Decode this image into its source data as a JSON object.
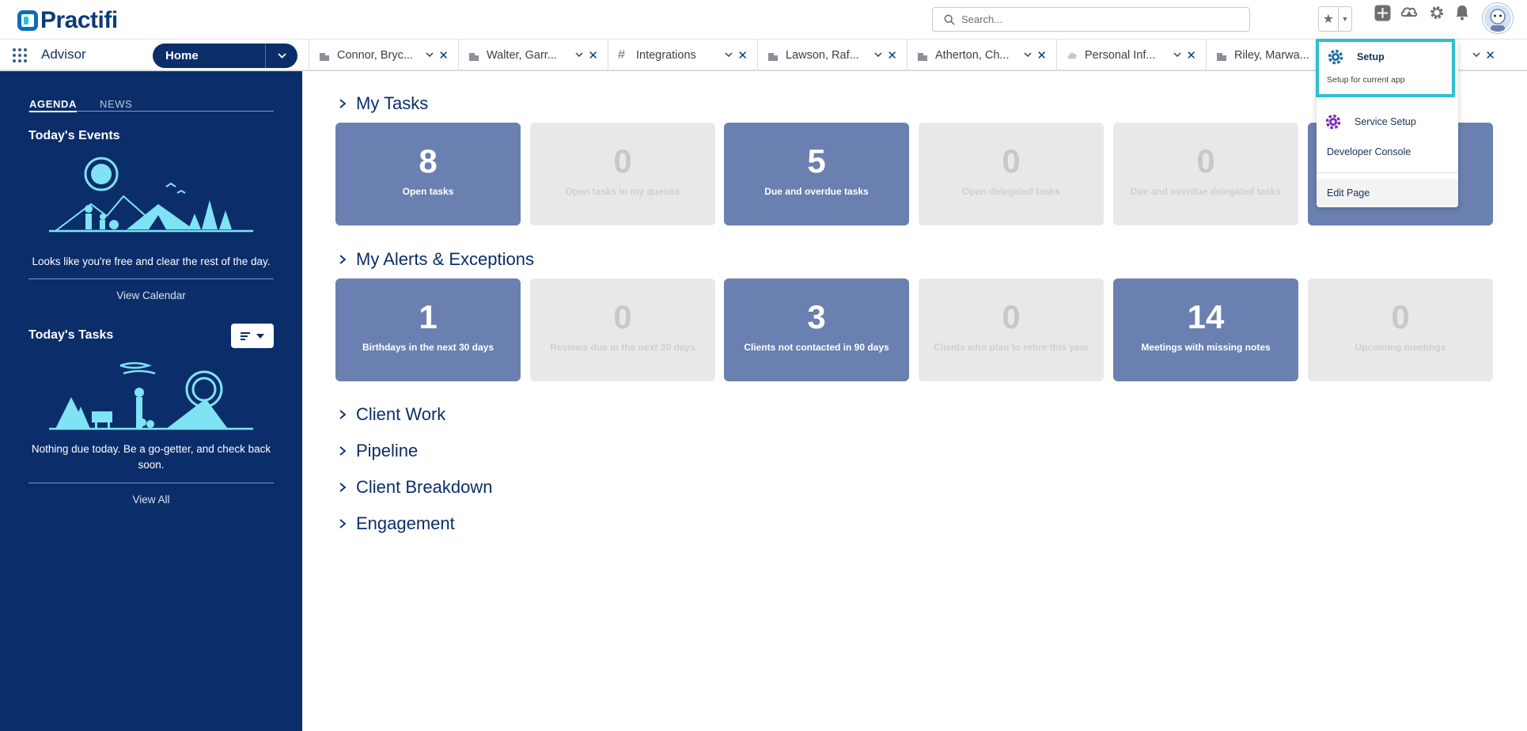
{
  "brand": {
    "name": "Practifi"
  },
  "search": {
    "placeholder": "Search..."
  },
  "nav": {
    "app_name": "Advisor",
    "home_tab": "Home",
    "tabs": [
      {
        "label": "Connor, Bryc...",
        "icon": "account-icon"
      },
      {
        "label": "Walter, Garr...",
        "icon": "account-icon"
      },
      {
        "label": "Integrations",
        "icon": "hash-icon"
      },
      {
        "label": "Lawson, Raf...",
        "icon": "account-icon"
      },
      {
        "label": "Atherton, Ch...",
        "icon": "account-icon"
      },
      {
        "label": "Personal Inf...",
        "icon": "cloud-icon"
      },
      {
        "label": "Riley, Marwa...",
        "icon": "account-icon"
      }
    ]
  },
  "sidebar": {
    "tabs": [
      "AGENDA",
      "NEWS"
    ],
    "events": {
      "heading": "Today's Events",
      "empty_text": "Looks like you're free and clear the rest of the day.",
      "link": "View Calendar"
    },
    "tasks": {
      "heading": "Today's Tasks",
      "empty_text": "Nothing due today. Be a go-getter, and check back soon.",
      "link": "View All"
    }
  },
  "sections": {
    "my_tasks": {
      "title": "My Tasks",
      "cards": [
        {
          "value": "8",
          "label": "Open tasks",
          "active": true
        },
        {
          "value": "0",
          "label": "Open tasks in my queues",
          "active": false
        },
        {
          "value": "5",
          "label": "Due and overdue tasks",
          "active": true
        },
        {
          "value": "0",
          "label": "Open delegated tasks",
          "active": false
        },
        {
          "value": "0",
          "label": "Due and overdue delegated tasks",
          "active": false
        },
        {
          "value": "",
          "label": "",
          "active": true
        }
      ]
    },
    "alerts": {
      "title": "My Alerts & Exceptions",
      "cards": [
        {
          "value": "1",
          "label": "Birthdays in the next 30 days",
          "active": true
        },
        {
          "value": "0",
          "label": "Reviews due in the next 30 days",
          "active": false
        },
        {
          "value": "3",
          "label": "Clients not contacted in 90 days",
          "active": true
        },
        {
          "value": "0",
          "label": "Clients who plan to retire this year",
          "active": false
        },
        {
          "value": "14",
          "label": "Meetings with missing notes",
          "active": true
        },
        {
          "value": "0",
          "label": "Upcoming meetings",
          "active": false
        }
      ]
    },
    "collapsed": [
      "Client Work",
      "Pipeline",
      "Client Breakdown",
      "Engagement"
    ]
  },
  "setup_menu": {
    "setup_title": "Setup",
    "setup_subtitle": "Setup for current app",
    "service_setup": "Service Setup",
    "developer_console": "Developer Console",
    "edit_page": "Edit Page"
  },
  "colors": {
    "brand_navy": "#0b2e6a",
    "card_active": "#6a80b0",
    "card_inactive": "#e8e8e8",
    "highlight": "#2cc0d0"
  }
}
